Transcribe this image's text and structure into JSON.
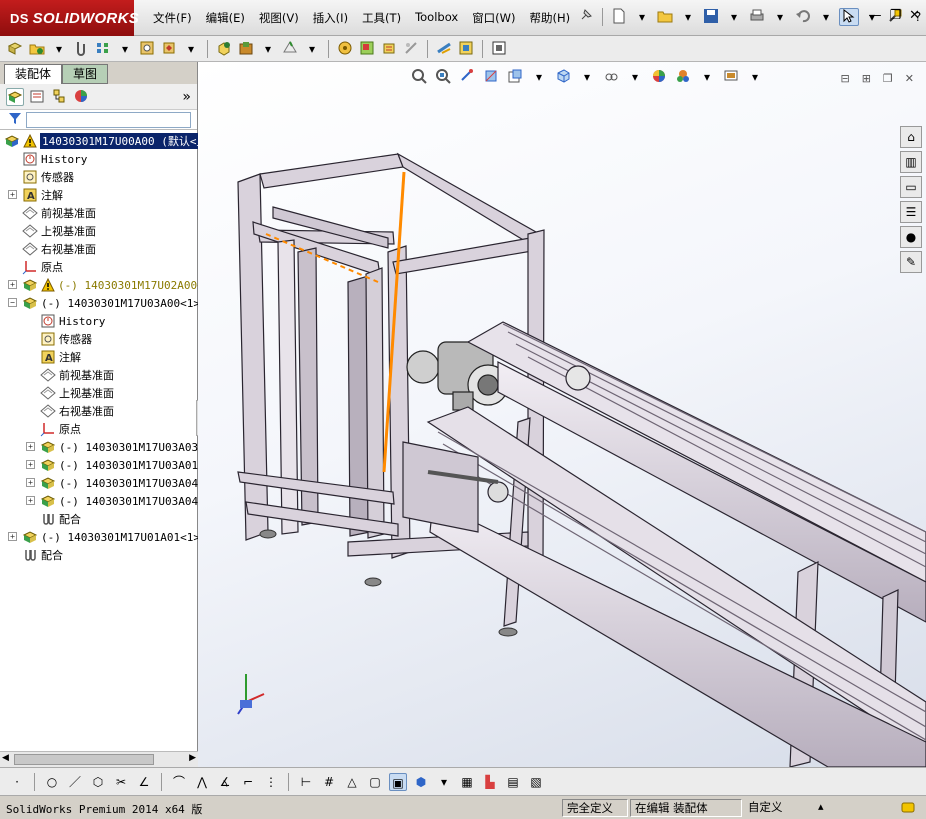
{
  "app": {
    "brand": "SOLIDWORKS",
    "brand_prefix": "DS"
  },
  "menu": [
    "文件(F)",
    "编辑(E)",
    "视图(V)",
    "插入(I)",
    "工具(T)",
    "Toolbox",
    "窗口(W)",
    "帮助(H)"
  ],
  "panel": {
    "tabs": [
      "装配体",
      "草图"
    ],
    "expand_glyph": "»",
    "tree": [
      {
        "label": "14030301M17U00A00  (默认<显",
        "level": 0,
        "icon": "assembly-icon",
        "warning": true,
        "selected": true
      },
      {
        "label": "History",
        "level": 1,
        "icon": "history-icon"
      },
      {
        "label": "传感器",
        "level": 1,
        "icon": "sensor-icon"
      },
      {
        "label": "注解",
        "level": 1,
        "icon": "annotation-icon",
        "expandable": true
      },
      {
        "label": "前视基准面",
        "level": 1,
        "icon": "plane-icon"
      },
      {
        "label": "上视基准面",
        "level": 1,
        "icon": "plane-icon"
      },
      {
        "label": "右视基准面",
        "level": 1,
        "icon": "plane-icon"
      },
      {
        "label": "原点",
        "level": 1,
        "icon": "origin-icon"
      },
      {
        "label": "(-) 14030301M17U02A00<1",
        "level": 1,
        "icon": "subassembly-icon",
        "warning": true,
        "expandable": true,
        "color": "#8a7a00"
      },
      {
        "label": "(-) 14030301M17U03A00<1>",
        "level": 1,
        "icon": "subassembly-icon",
        "expandable": true,
        "expanded": true
      },
      {
        "label": "History",
        "level": 2,
        "icon": "history-icon"
      },
      {
        "label": "传感器",
        "level": 2,
        "icon": "sensor-icon"
      },
      {
        "label": "注解",
        "level": 2,
        "icon": "annotation-icon"
      },
      {
        "label": "前视基准面",
        "level": 2,
        "icon": "plane-icon"
      },
      {
        "label": "上视基准面",
        "level": 2,
        "icon": "plane-icon"
      },
      {
        "label": "右视基准面",
        "level": 2,
        "icon": "plane-icon"
      },
      {
        "label": "原点",
        "level": 2,
        "icon": "origin-icon"
      },
      {
        "label": "(-) 14030301M17U03A03<",
        "level": 2,
        "icon": "subassembly-icon",
        "expandable": true
      },
      {
        "label": "(-) 14030301M17U03A01<",
        "level": 2,
        "icon": "subassembly-icon",
        "expandable": true
      },
      {
        "label": "(-) 14030301M17U03A04<",
        "level": 2,
        "icon": "subassembly-icon",
        "expandable": true
      },
      {
        "label": "(-) 14030301M17U03A04<",
        "level": 2,
        "icon": "subassembly-icon",
        "expandable": true
      },
      {
        "label": "配合",
        "level": 2,
        "icon": "mates-icon"
      },
      {
        "label": "(-) 14030301M17U01A01<1>",
        "level": 1,
        "icon": "subassembly-icon",
        "expandable": true
      },
      {
        "label": "配合",
        "level": 1,
        "icon": "mates-icon"
      }
    ]
  },
  "status": {
    "app_version": "SolidWorks Premium 2014 x64 版",
    "fields": [
      "完全定义",
      "在编辑 装配体",
      "自定义"
    ]
  },
  "colors": {
    "accent_red": "#b01818",
    "selection": "#0a246a",
    "highlight_edge": "#ff8a00"
  }
}
